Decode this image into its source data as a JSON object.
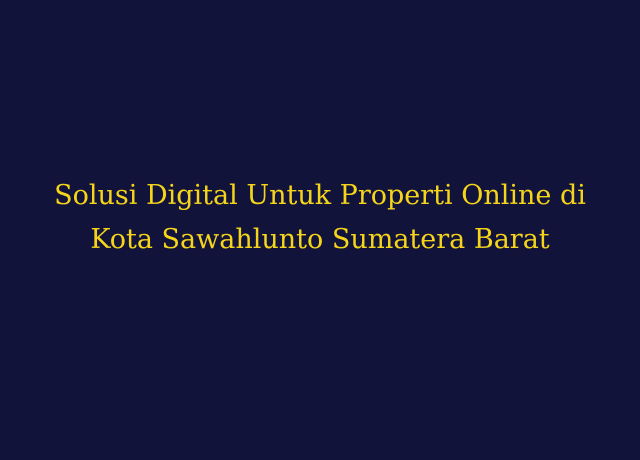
{
  "title": {
    "line1": "Solusi Digital Untuk Properti Online di",
    "line2": "Kota Sawahlunto Sumatera Barat",
    "color": "#f5d51a"
  },
  "background_color": "#12133a"
}
